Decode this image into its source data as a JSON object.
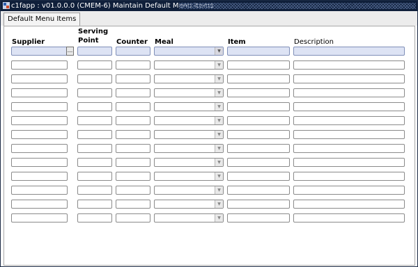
{
  "window": {
    "title": "c1fapp : v01.0.0.0 (CMEM-6) Maintain Default Menu Items"
  },
  "tabs": [
    {
      "label": "Default Menu Items"
    }
  ],
  "columns": {
    "supplier": "Supplier",
    "serving_point_line1": "Serving",
    "serving_point_line2": "Point",
    "counter": "Counter",
    "meal": "Meal",
    "item": "Item",
    "description": "Description"
  },
  "lookup_button_label": "...",
  "dropdown_icon": "chevron-down-icon",
  "row_count": 13,
  "colors": {
    "titlebar": "#0f1f3a",
    "active_field": "#dde3f4"
  }
}
